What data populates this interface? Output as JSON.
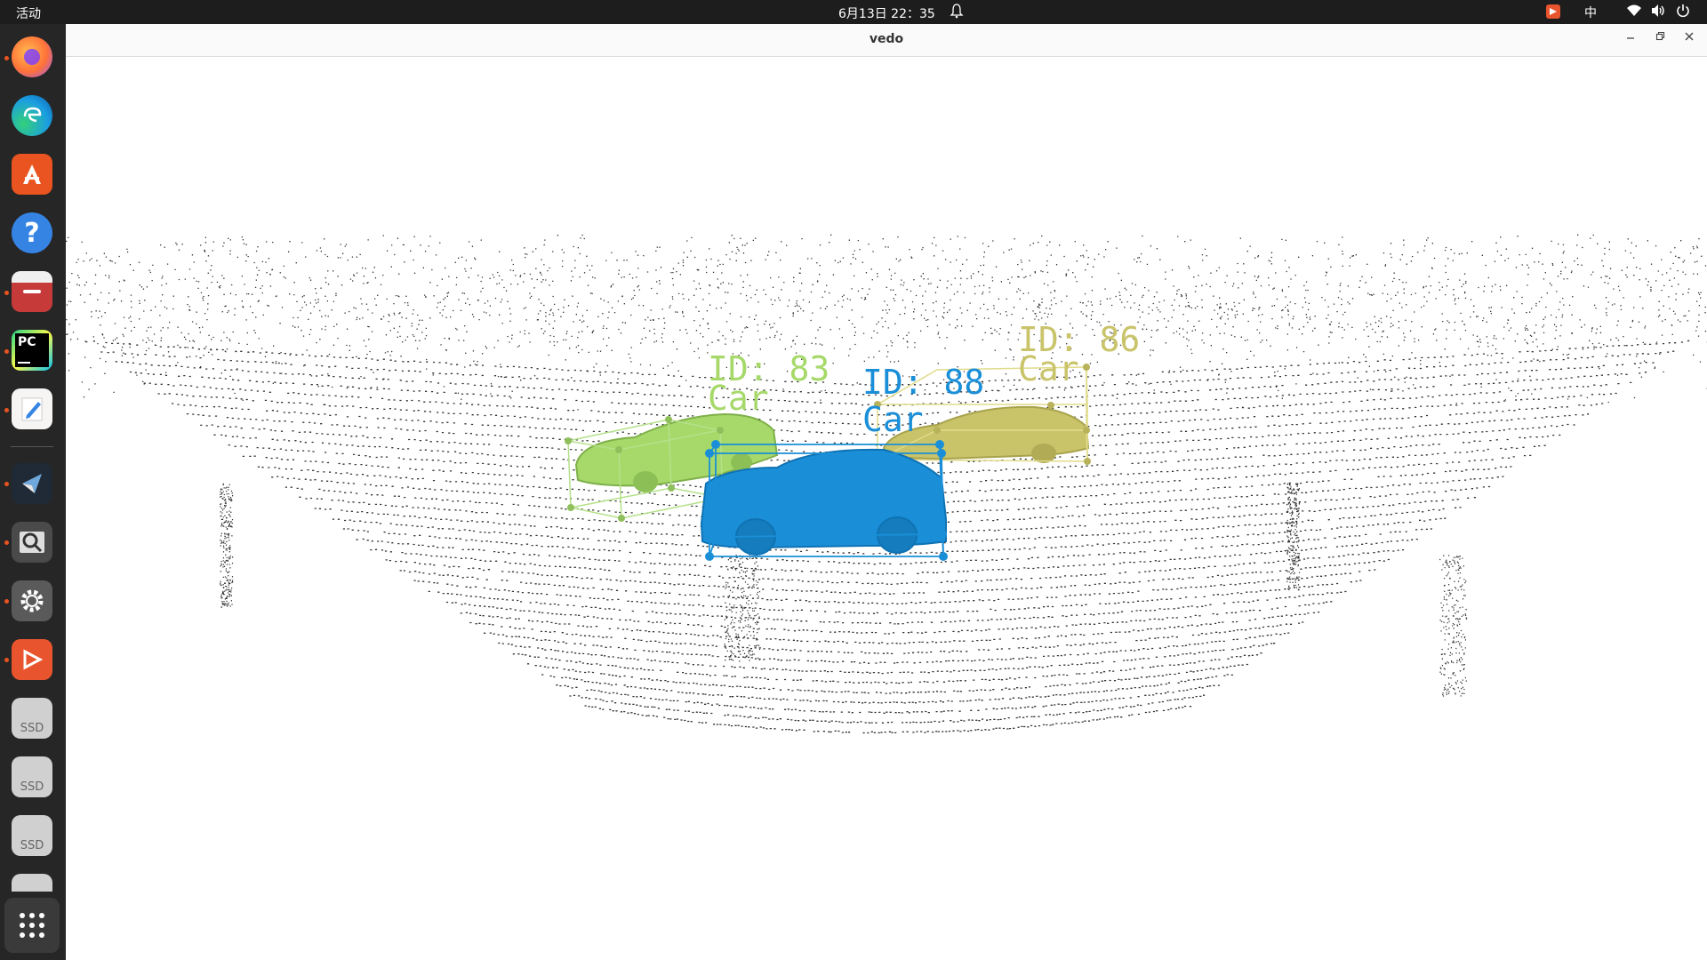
{
  "topbar": {
    "activities": "活动",
    "clock": "6月13日  22：35",
    "input_method": "中"
  },
  "window": {
    "title": "vedo"
  },
  "dock": {
    "ssd1": "SSD",
    "ssd2": "SSD",
    "ssd3": "SSD"
  },
  "detections": [
    {
      "id_label": "ID: 83",
      "class_label": "Car",
      "color": "#a6d96a"
    },
    {
      "id_label": "ID: 88",
      "class_label": "Car",
      "color": "#1a8fd8"
    },
    {
      "id_label": "ID: 86",
      "class_label": "Car",
      "color": "#c9c46a"
    }
  ],
  "colors": {
    "topbar": "#1d1d1d",
    "dock": "#262626",
    "point_cloud": "#333333",
    "car_green": "#a6d96a",
    "car_blue": "#1a8fd8",
    "car_olive": "#c9c46a"
  }
}
